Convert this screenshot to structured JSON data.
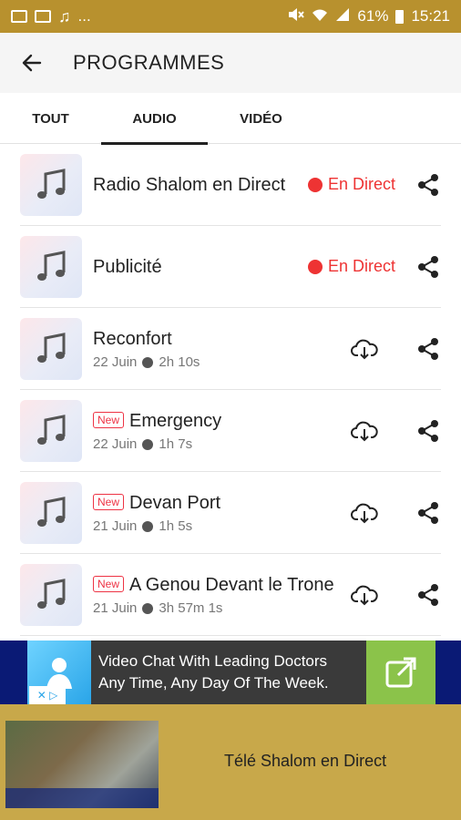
{
  "status": {
    "battery": "61%",
    "time": "15:21",
    "more": "..."
  },
  "header": {
    "title": "PROGRAMMES"
  },
  "tabs": [
    {
      "label": "TOUT",
      "active": false
    },
    {
      "label": "AUDIO",
      "active": true
    },
    {
      "label": "VIDÉO",
      "active": false
    }
  ],
  "items": [
    {
      "title": "Radio Shalom en Direct",
      "live": "En Direct"
    },
    {
      "title": "Publicité",
      "live": "En Direct"
    },
    {
      "title": "Reconfort",
      "date": "22 Juin",
      "duration": "2h 10s"
    },
    {
      "title": "Emergency",
      "new": "New",
      "date": "22 Juin",
      "duration": "1h 7s"
    },
    {
      "title": "Devan Port",
      "new": "New",
      "date": "21 Juin",
      "duration": "1h 5s"
    },
    {
      "title": "A Genou Devant le Trone",
      "new": "New",
      "date": "21 Juin",
      "duration": "3h 57m 1s"
    }
  ],
  "ad": {
    "line1": "Video Chat With Leading Doctors",
    "line2": "Any Time, Any Day Of The Week."
  },
  "player": {
    "title": "Télé Shalom en Direct"
  },
  "colors": {
    "brand": "#b8912e",
    "live": "#e33333",
    "ad_bg": "#0a1a75"
  }
}
